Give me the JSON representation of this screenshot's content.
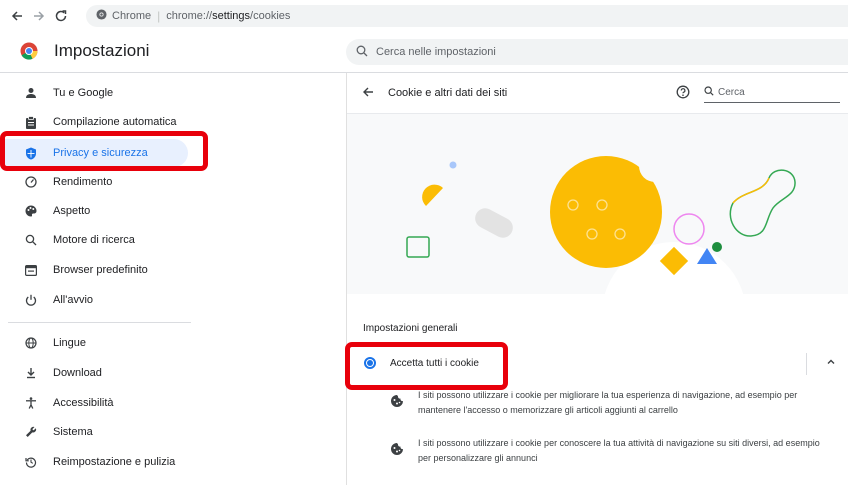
{
  "browser": {
    "site_name": "Chrome",
    "url_prefix": "chrome://",
    "url_path": "settings",
    "url_suffix": "/cookies"
  },
  "header": {
    "title": "Impostazioni",
    "search_placeholder": "Cerca nelle impostazioni"
  },
  "sidebar": {
    "items": [
      {
        "label": "Tu e Google",
        "icon": "person-icon"
      },
      {
        "label": "Compilazione automatica",
        "icon": "clipboard-icon"
      },
      {
        "label": "Privacy e sicurezza",
        "icon": "shield-icon",
        "active": true
      },
      {
        "label": "Rendimento",
        "icon": "speedometer-icon"
      },
      {
        "label": "Aspetto",
        "icon": "palette-icon"
      },
      {
        "label": "Motore di ricerca",
        "icon": "search-icon"
      },
      {
        "label": "Browser predefinito",
        "icon": "browser-icon"
      },
      {
        "label": "All'avvio",
        "icon": "power-icon"
      }
    ],
    "items2": [
      {
        "label": "Lingue",
        "icon": "globe-icon"
      },
      {
        "label": "Download",
        "icon": "download-icon"
      },
      {
        "label": "Accessibilità",
        "icon": "accessibility-icon"
      },
      {
        "label": "Sistema",
        "icon": "wrench-icon"
      },
      {
        "label": "Reimpostazione e pulizia",
        "icon": "restore-icon"
      }
    ]
  },
  "page": {
    "title": "Cookie e altri dati dei siti",
    "search_placeholder": "Cerca",
    "section_label": "Impostazioni generali",
    "option_label": "Accetta tutti i cookie",
    "desc1": "I siti possono utilizzare i cookie per migliorare la tua esperienza di navigazione, ad esempio per mantenere l'accesso o memorizzare gli articoli aggiunti al carrello",
    "desc2": "I siti possono utilizzare i cookie per conoscere la tua attività di navigazione su siti diversi, ad esempio per personalizzare gli annunci"
  },
  "colors": {
    "accent": "#1a73e8",
    "highlight": "#e8000b",
    "cookie": "#fbbc04"
  }
}
